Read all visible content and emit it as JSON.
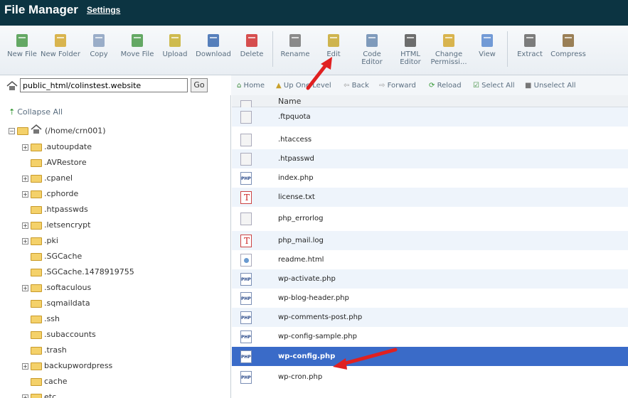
{
  "header": {
    "title": "File Manager",
    "settings": "Settings"
  },
  "toolbar": [
    {
      "label": "New File",
      "icon": "new-file-icon"
    },
    {
      "label": "New Folder",
      "icon": "new-folder-icon"
    },
    {
      "label": "Copy",
      "icon": "copy-icon"
    },
    {
      "label": "Move File",
      "icon": "move-file-icon"
    },
    {
      "label": "Upload",
      "icon": "upload-icon"
    },
    {
      "label": "Download",
      "icon": "download-icon"
    },
    {
      "label": "Delete",
      "icon": "delete-icon"
    },
    {
      "label": "Rename",
      "icon": "rename-icon"
    },
    {
      "label": "Edit",
      "icon": "edit-icon"
    },
    {
      "label": "Code Editor",
      "icon": "code-editor-icon"
    },
    {
      "label": "HTML Editor",
      "icon": "html-editor-icon"
    },
    {
      "label": "Change Permissi...",
      "icon": "permissions-icon"
    },
    {
      "label": "View",
      "icon": "view-icon"
    },
    {
      "label": "Extract",
      "icon": "extract-icon"
    },
    {
      "label": "Compress",
      "icon": "compress-icon"
    }
  ],
  "path": {
    "value": "public_html/colinstest.website",
    "go": "Go"
  },
  "nav": {
    "home": "Home",
    "up": "Up One Level",
    "back": "Back",
    "forward": "Forward",
    "reload": "Reload",
    "select_all": "Select All",
    "unselect_all": "Unselect All"
  },
  "tree": {
    "collapse": "Collapse All",
    "root": "(/home/crn001)",
    "items": [
      ".autoupdate",
      ".AVRestore",
      ".cpanel",
      ".cphorde",
      ".htpasswds",
      ".letsencrypt",
      ".pki",
      ".SGCache",
      ".SGCache.1478919755",
      ".softaculous",
      ".sqmaildata",
      ".ssh",
      ".subaccounts",
      ".trash",
      "backupwordpress",
      "cache",
      "etc"
    ]
  },
  "list": {
    "col_name": "Name",
    "files": [
      ".ftpquota",
      ".htaccess",
      ".htpasswd",
      "index.php",
      "license.txt",
      "php_errorlog",
      "php_mail.log",
      "readme.html",
      "wp-activate.php",
      "wp-blog-header.php",
      "wp-comments-post.php",
      "wp-config-sample.php",
      "wp-config.php",
      "wp-cron.php"
    ],
    "selected": "wp-config.php"
  }
}
